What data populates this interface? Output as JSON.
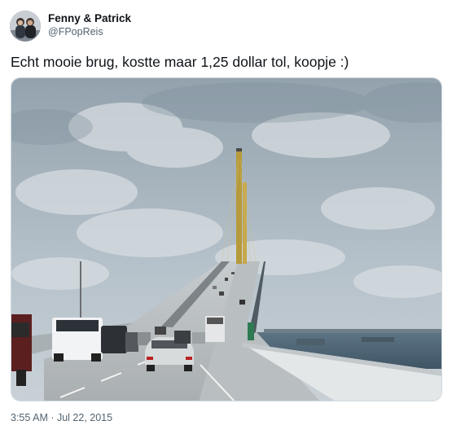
{
  "author": {
    "display_name": "Fenny & Patrick",
    "handle": "@FPopReis",
    "avatar_icon": "profile-photo"
  },
  "tweet": {
    "text": "Echt mooie brug, kostte maar 1,25 dollar tol, koopje :)",
    "timestamp": "3:55 AM · Jul 22, 2015",
    "media_type": "photo"
  },
  "colors": {
    "text_primary": "#0f1419",
    "text_secondary": "#536471",
    "border": "#cfd9de"
  }
}
